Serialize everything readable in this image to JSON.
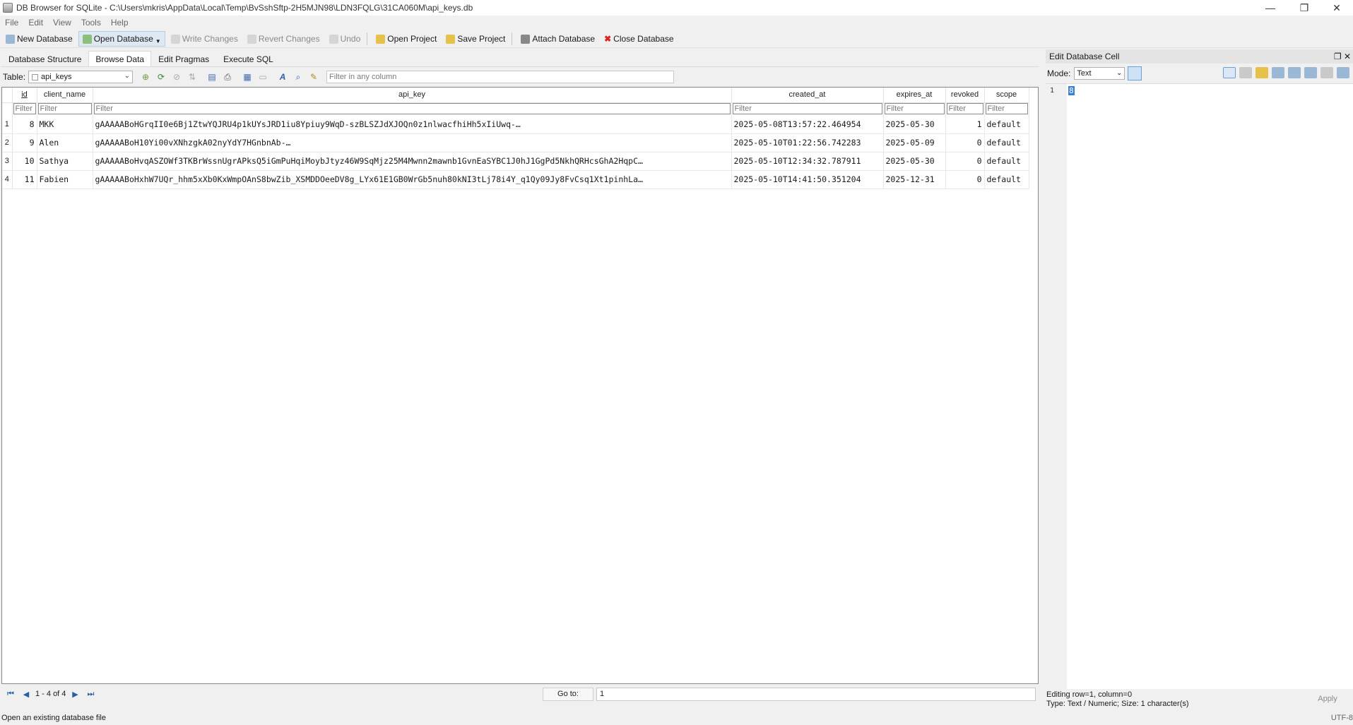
{
  "window": {
    "title": "DB Browser for SQLite - C:\\Users\\mkris\\AppData\\Local\\Temp\\BvSshSftp-2H5MJN98\\LDN3FQLG\\31CA060M\\api_keys.db",
    "minimize": "—",
    "maximize": "❐",
    "close": "✕"
  },
  "menu": [
    "File",
    "Edit",
    "View",
    "Tools",
    "Help"
  ],
  "toolbar": {
    "new_database": "New Database",
    "open_database": "Open Database",
    "write_changes": "Write Changes",
    "revert_changes": "Revert Changes",
    "undo": "Undo",
    "open_project": "Open Project",
    "save_project": "Save Project",
    "attach_database": "Attach Database",
    "close_database": "Close Database"
  },
  "tabs": [
    "Database Structure",
    "Browse Data",
    "Edit Pragmas",
    "Execute SQL"
  ],
  "browse": {
    "table_label": "Table:",
    "table_value": "api_keys",
    "filter_placeholder": "Filter in any column",
    "columns": [
      "id",
      "client_name",
      "api_key",
      "created_at",
      "expires_at",
      "revoked",
      "scope"
    ],
    "filter_placeholder_short": "Filter",
    "rows": [
      {
        "row": "1",
        "id": "8",
        "client_name": "MKK",
        "api_key": "gAAAAABoHGrqII0e6Bj1ZtwYQJRU4p1kUYsJRD1iu8Ypiuy9WqD-szBLSZJdXJOQn0z1nlwacfhiHh5xIiUwq-…",
        "created_at": "2025-05-08T13:57:22.464954",
        "expires_at": "2025-05-30",
        "revoked": "1",
        "scope": "default"
      },
      {
        "row": "2",
        "id": "9",
        "client_name": "Alen",
        "api_key": "gAAAAABoH10Yi00vXNhzgkA02nyYdY7HGnbnAb-…",
        "created_at": "2025-05-10T01:22:56.742283",
        "expires_at": "2025-05-09",
        "revoked": "0",
        "scope": "default"
      },
      {
        "row": "3",
        "id": "10",
        "client_name": "Sathya",
        "api_key": "gAAAAABoHvqASZOWf3TKBrWssnUgrAPksQ5iGmPuHqiMoybJtyz46W9SqMjz25M4Mwnn2mawnb1GvnEaSYBC1J0hJ1GgPd5NkhQRHcsGhA2HqpC…",
        "created_at": "2025-05-10T12:34:32.787911",
        "expires_at": "2025-05-30",
        "revoked": "0",
        "scope": "default"
      },
      {
        "row": "4",
        "id": "11",
        "client_name": "Fabien",
        "api_key": "gAAAAABoHxhW7UQr_hhm5xXb0KxWmpOAnS8bwZib_XSMDDOeeDV8g_LYx61E1GB0WrGb5nuh80kNI3tLj78i4Y_q1Qy09Jy8FvCsq1Xt1pinhLa…",
        "created_at": "2025-05-10T14:41:50.351204",
        "expires_at": "2025-12-31",
        "revoked": "0",
        "scope": "default"
      }
    ],
    "record_count": "1 - 4 of 4",
    "goto_label": "Go to:",
    "goto_value": "1"
  },
  "dock": {
    "title": "Edit Database Cell",
    "mode_label": "Mode:",
    "mode_value": "Text",
    "line_number": "1",
    "cell_value": "8",
    "status_line1": "Editing row=1, column=0",
    "status_line2": "Type: Text / Numeric; Size: 1 character(s)",
    "apply": "Apply"
  },
  "statusbar": {
    "message": "Open an existing database file",
    "encoding": "UTF-8"
  }
}
